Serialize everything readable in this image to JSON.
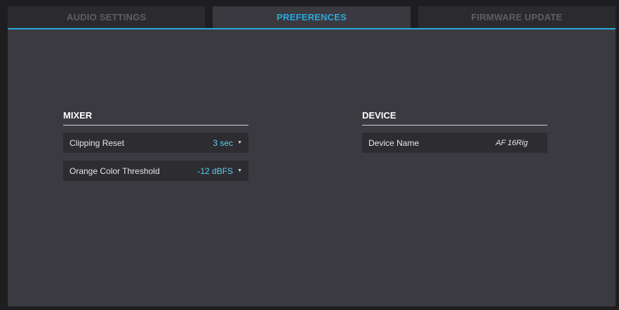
{
  "tabs": [
    {
      "label": "AUDIO SETTINGS",
      "active": false
    },
    {
      "label": "PREFERENCES",
      "active": true
    },
    {
      "label": "FIRMWARE UPDATE",
      "active": false
    }
  ],
  "colors": {
    "accent": "#2aa8dc",
    "value_text": "#5ecdf0",
    "panel_bg": "#3b3a40"
  },
  "mixer": {
    "title": "MIXER",
    "clipping_reset": {
      "label": "Clipping Reset",
      "value": "3 sec",
      "icon": "caret-down-icon"
    },
    "orange_threshold": {
      "label": "Orange Color Threshold",
      "value": "-12 dBFS",
      "icon": "caret-down-icon"
    }
  },
  "device": {
    "title": "DEVICE",
    "device_name": {
      "label": "Device Name",
      "value": "AF 16Rig"
    }
  }
}
